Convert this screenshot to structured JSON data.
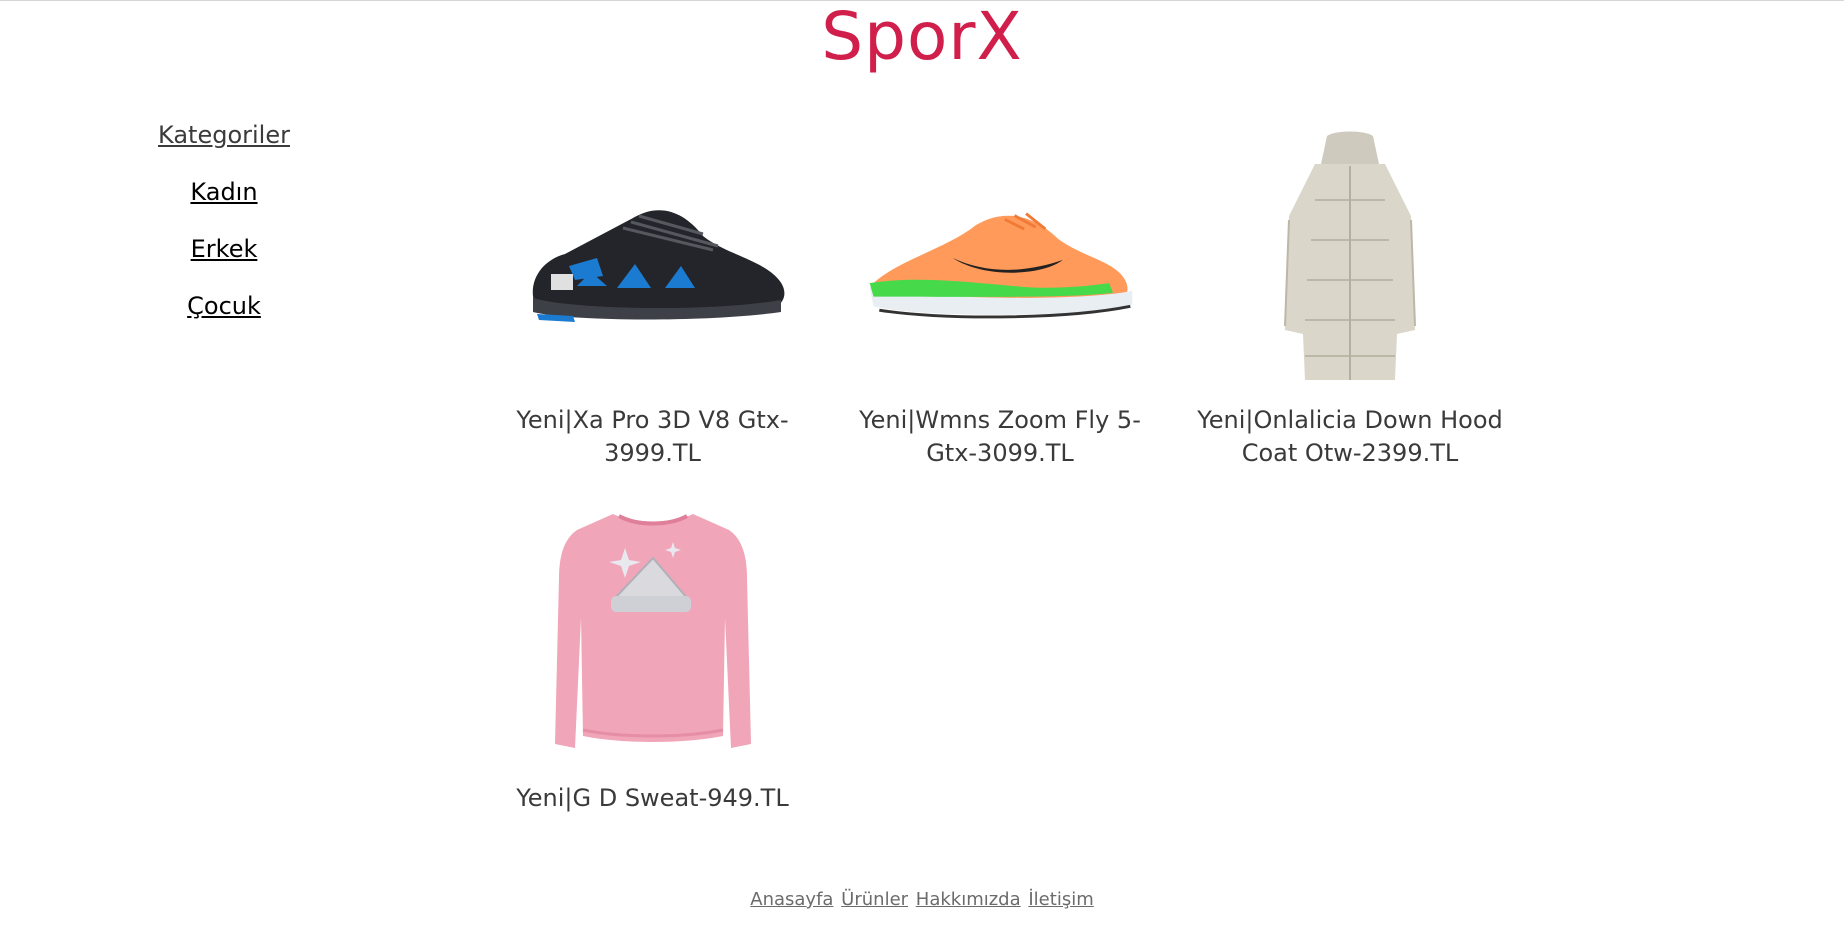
{
  "header": {
    "brand": "SporX"
  },
  "sidebar": {
    "heading": "Kategoriler",
    "items": [
      {
        "label": "Kadın"
      },
      {
        "label": "Erkek"
      },
      {
        "label": "Çocuk"
      }
    ]
  },
  "products": [
    {
      "caption": "Yeni|Xa Pro 3D V8 Gtx-3999.TL",
      "image": "black-trail-shoe"
    },
    {
      "caption": "Yeni|Wmns Zoom Fly 5- Gtx-3099.TL",
      "image": "orange-running-shoe"
    },
    {
      "caption": "Yeni|Onlalicia Down Hood Coat Otw-2399.TL",
      "image": "beige-puffer-coat"
    },
    {
      "caption": "Yeni|G D Sweat-949.TL",
      "image": "pink-sweatshirt"
    }
  ],
  "footer": {
    "links": [
      {
        "label": "Anasayfa"
      },
      {
        "label": "Ürünler"
      },
      {
        "label": "Hakkımızda"
      },
      {
        "label": "İletişim"
      }
    ]
  },
  "colors": {
    "brand": "#d11f4b",
    "text": "#3a3a3a",
    "footer": "#6b6b6b"
  }
}
